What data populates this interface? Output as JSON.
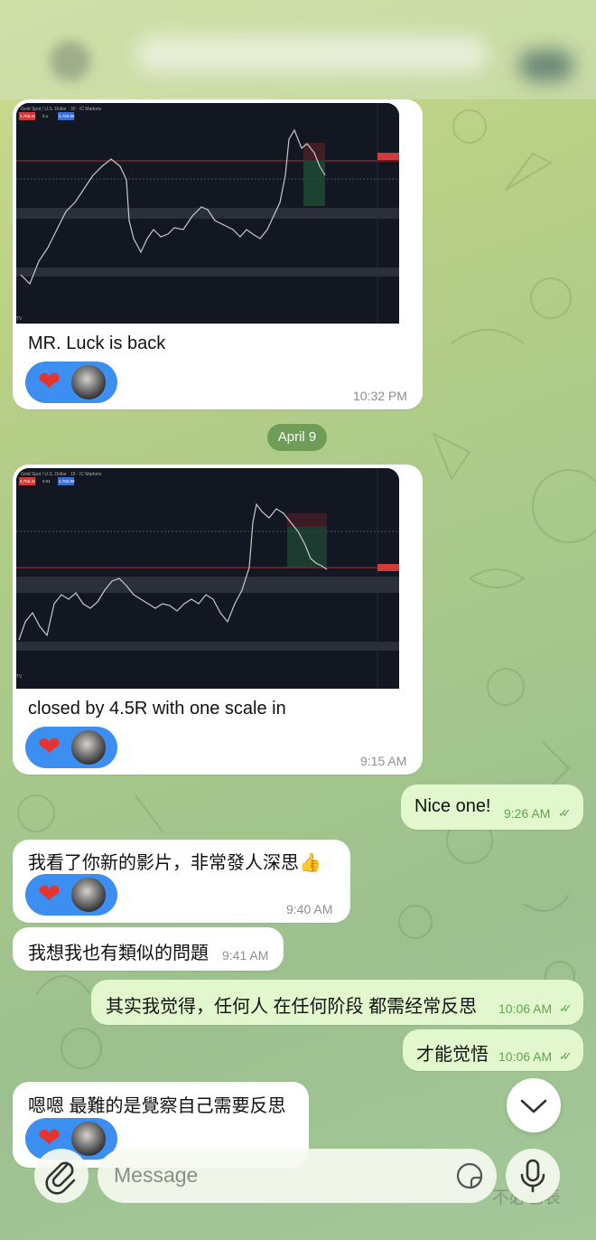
{
  "messages": [
    {
      "caption": "MR. Luck is back",
      "time": "10:32 PM"
    },
    {
      "caption": "closed by 4.5R with one scale in",
      "time": "9:15 AM"
    },
    {
      "text": "Nice one!",
      "time": "9:26 AM"
    },
    {
      "text": "我看了你新的影片，非常發人深思",
      "emoji": "👍",
      "time": "9:40 AM"
    },
    {
      "text": "我想我也有類似的問題",
      "time": "9:41 AM"
    },
    {
      "text": "其实我觉得，任何人 在任何阶段 都需经常反思",
      "time": "10:06 AM"
    },
    {
      "text": "才能觉悟",
      "time": "10:06 AM"
    },
    {
      "text": "嗯嗯 最難的是覺察自己需要反思"
    }
  ],
  "date_separator": "April 9",
  "reaction_heart": "❤",
  "composer": {
    "placeholder": "Message"
  },
  "icons": {
    "attach": "paperclip-icon",
    "sticker": "sticker-icon",
    "mic": "microphone-icon",
    "scroll": "chevron-down-icon"
  },
  "colors": {
    "reaction": "#3d8ef1",
    "outgoing": "#e3f7cf",
    "check": "#5fa64a"
  },
  "charts": [
    {
      "title": "Gold Spot / U.S. Dollar · 30 · IC Markets",
      "bid": "4,756.41",
      "ask": "4,756.90",
      "lot": "0.1"
    },
    {
      "title": "Gold Spot / U.S. Dollar · 15 · IC Markets",
      "bid": "4,755.41",
      "ask": "4,755.90",
      "lot": "0.01"
    }
  ],
  "bottom_ghost": "不必也表"
}
